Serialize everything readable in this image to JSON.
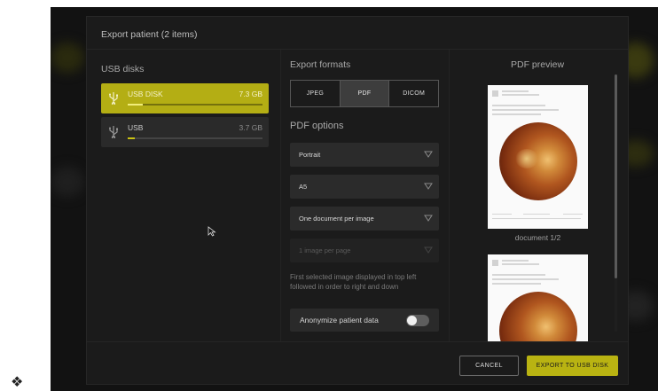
{
  "dialog": {
    "title": "Export patient (2 items)"
  },
  "usb_section": {
    "title": "USB disks",
    "disks": [
      {
        "name": "USB DISK",
        "size": "7.3 GB",
        "used_fraction": 0.11,
        "selected": true
      },
      {
        "name": "USB",
        "size": "3.7 GB",
        "used_fraction": 0.05,
        "selected": false
      }
    ]
  },
  "export_formats": {
    "title": "Export formats",
    "options": [
      "JPEG",
      "PDF",
      "DICOM"
    ],
    "selected": "PDF"
  },
  "pdf_options": {
    "title": "PDF options",
    "orientation": "Portrait",
    "paper_size": "A5",
    "layout": "One document per image",
    "images_per_page": "1 image per page",
    "order_note": "First selected image displayed in top left followed in order to right and down",
    "anonymize_label": "Anonymize patient data",
    "anonymize_on": false
  },
  "preview": {
    "title": "PDF preview",
    "document_label": "document 1/2"
  },
  "footer": {
    "cancel_label": "CANCEL",
    "export_label": "EXPORT TO USB DISK"
  },
  "colors": {
    "accent": "#b9b312",
    "dialog_bg": "#1b1b1b",
    "field_bg": "#2b2b2b"
  },
  "icons": {
    "usb": "usb-icon",
    "dropdown": "chevron-down-icon",
    "logo": "app-logo-icon",
    "cursor": "mouse-pointer-icon"
  }
}
